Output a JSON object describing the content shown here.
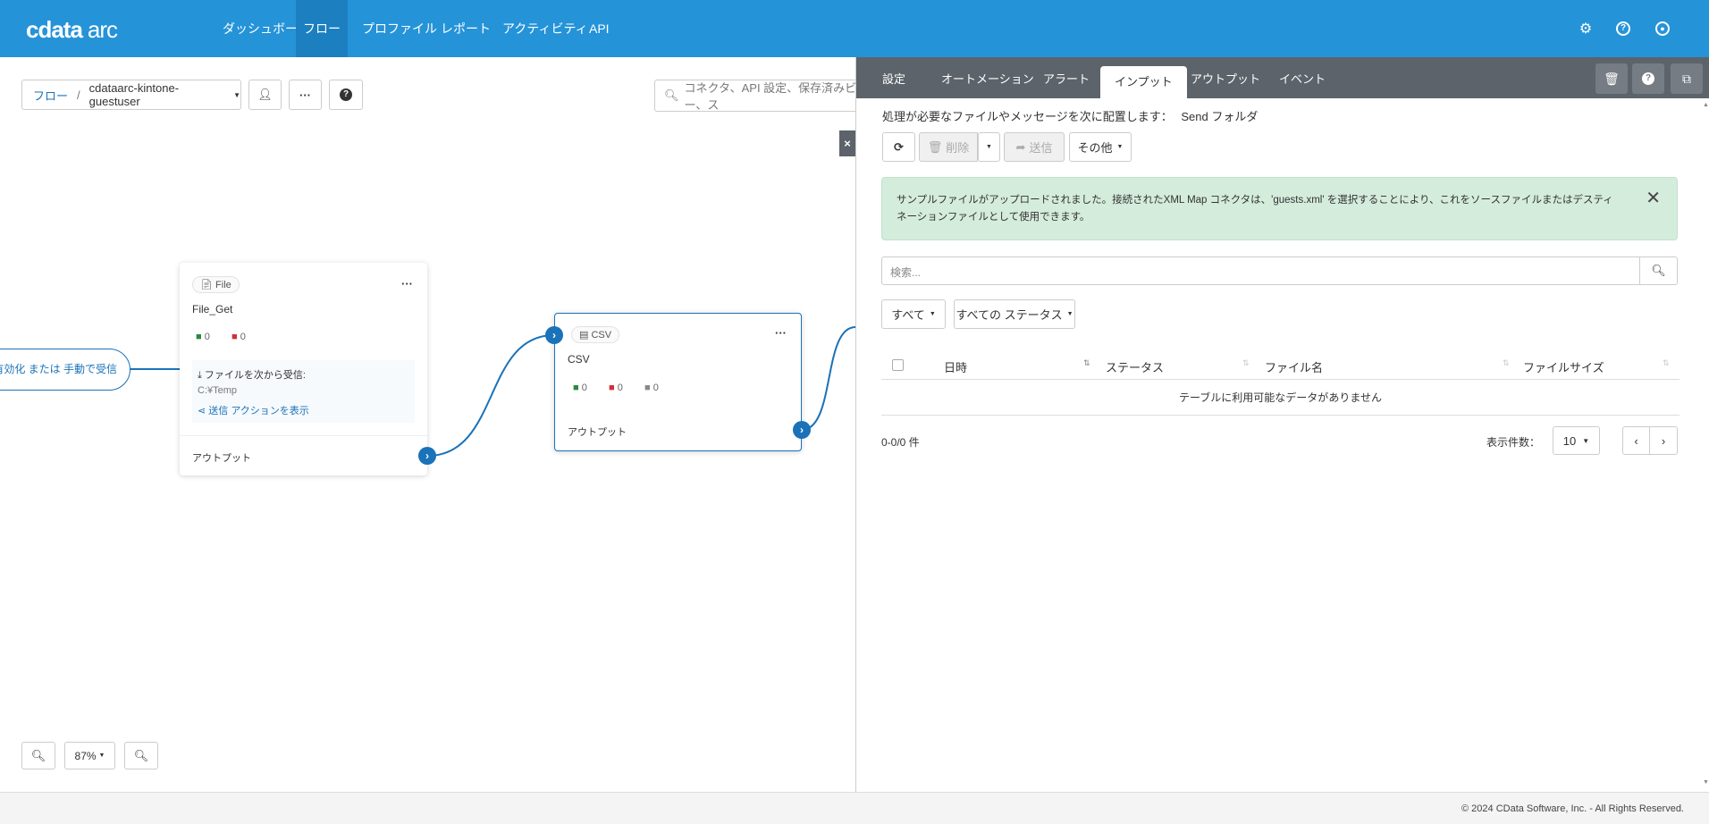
{
  "header": {
    "logo": "cdata arc",
    "nav": [
      {
        "label": "ダッシュボード",
        "active": false
      },
      {
        "label": "フロー",
        "active": true
      },
      {
        "label": "プロファイル",
        "active": false
      },
      {
        "label": "レポート",
        "active": false
      },
      {
        "label": "アクティビティ",
        "active": false
      },
      {
        "label": "API",
        "active": false
      }
    ],
    "icons": [
      "gear-icon",
      "help-icon",
      "user-icon"
    ]
  },
  "toolbar": {
    "breadcrumb_root": "フロー",
    "breadcrumb_sep": "/",
    "flow_name": "cdataarc-kintone-guestuser",
    "search_placeholder": "コネクタ、API 設定、保存済みビュー、ス"
  },
  "canvas": {
    "trigger_text": "を有効化 または 手動で受信",
    "zoom_level": "87%",
    "nodes": [
      {
        "type": "File",
        "name": "File_Get",
        "success": "0",
        "error": "0",
        "detail_label": "ファイルを次から受信:",
        "detail_path": "C:¥Temp",
        "detail_link": "送信 アクションを表示",
        "output": "アウトプット"
      },
      {
        "type": "CSV",
        "name": "CSV",
        "success": "0",
        "error": "0",
        "pending": "0",
        "output": "アウトプット"
      }
    ]
  },
  "panel": {
    "close": "×",
    "tabs": [
      {
        "label": "設定"
      },
      {
        "label": "オートメーション"
      },
      {
        "label": "アラート"
      },
      {
        "label": "インプット",
        "active": true
      },
      {
        "label": "アウトプット"
      },
      {
        "label": "イベント"
      }
    ],
    "desc": "処理が必要なファイルやメッセージを次に配置します：",
    "desc_folder": "Send フォルダ",
    "buttons": {
      "delete": "削除",
      "send": "送信",
      "other": "その他"
    },
    "alert": "サンプルファイルがアップロードされました。接続されたXML Map コネクタは、'guests.xml' を選択することにより、これをソースファイルまたはデスティネーションファイルとして使用できます。",
    "search_placeholder": "検索...",
    "filters": {
      "all": "すべて",
      "status": "すべての ステータス"
    },
    "table": {
      "columns": [
        "日時",
        "ステータス",
        "ファイル名",
        "ファイルサイズ"
      ],
      "empty": "テーブルに利用可能なデータがありません"
    },
    "count": "0-0/0 件",
    "page_size_label": "表示件数：",
    "page_size": "10"
  },
  "footer": {
    "copyright": "© 2024 CData Software, Inc. - All Rights Reserved."
  },
  "colors": {
    "header": "#2593d8",
    "panel_tabs": "#5c636a",
    "alert_bg": "#d4ecdc",
    "port": "#1a72b8"
  }
}
